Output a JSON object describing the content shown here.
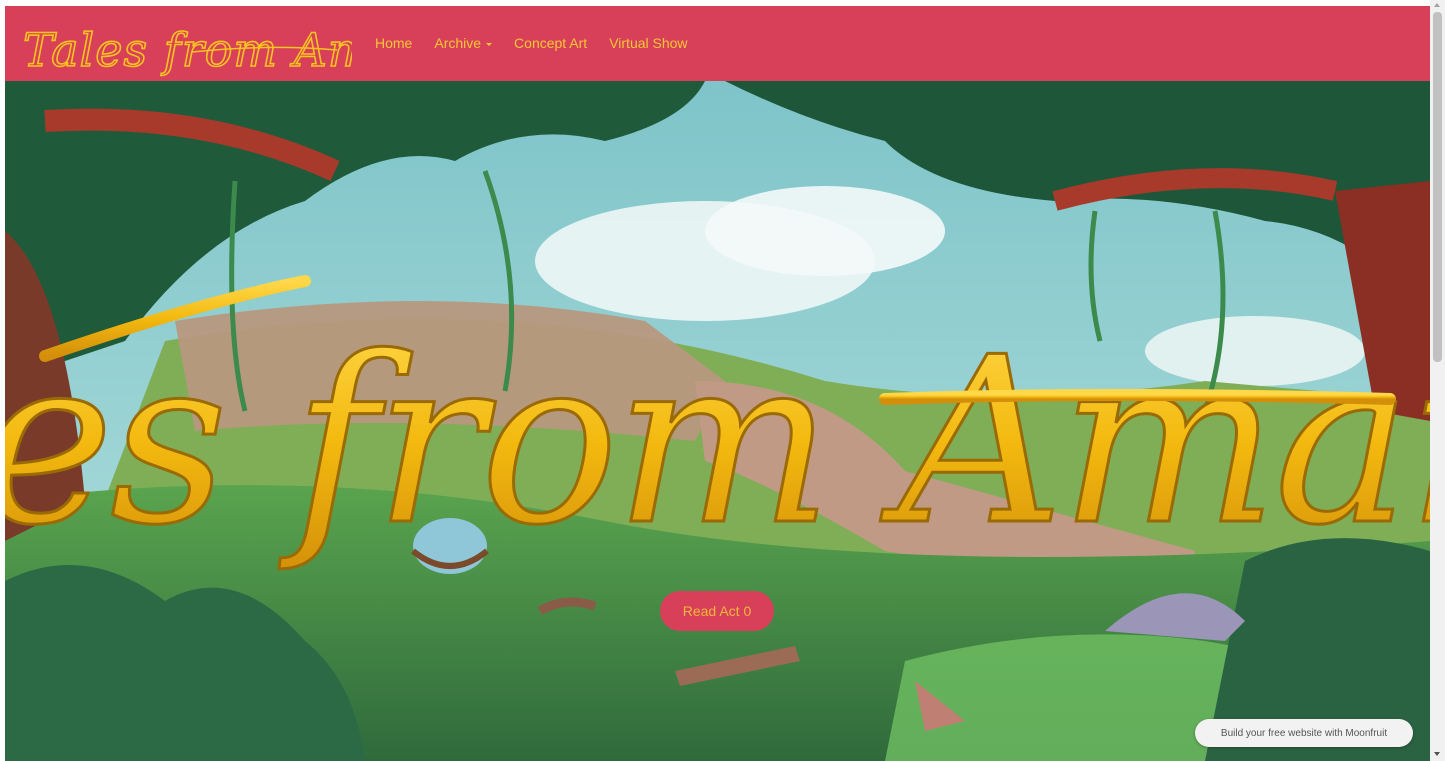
{
  "site": {
    "logo_text": "Tales from Amarna"
  },
  "nav": {
    "items": [
      {
        "label": "Home"
      },
      {
        "label": "Archive"
      },
      {
        "label": "Concept Art"
      },
      {
        "label": "Virtual Show"
      }
    ]
  },
  "hero": {
    "title": "Tales from Amarna",
    "cta_label": "Read Act 0"
  },
  "footer_badge": {
    "label": "Build your free website with Moonfruit"
  },
  "colors": {
    "nav_bg": "#d8405a",
    "nav_text": "#f5c634",
    "title_gold": "#f3b90f",
    "cta_bg": "#d8405a"
  }
}
